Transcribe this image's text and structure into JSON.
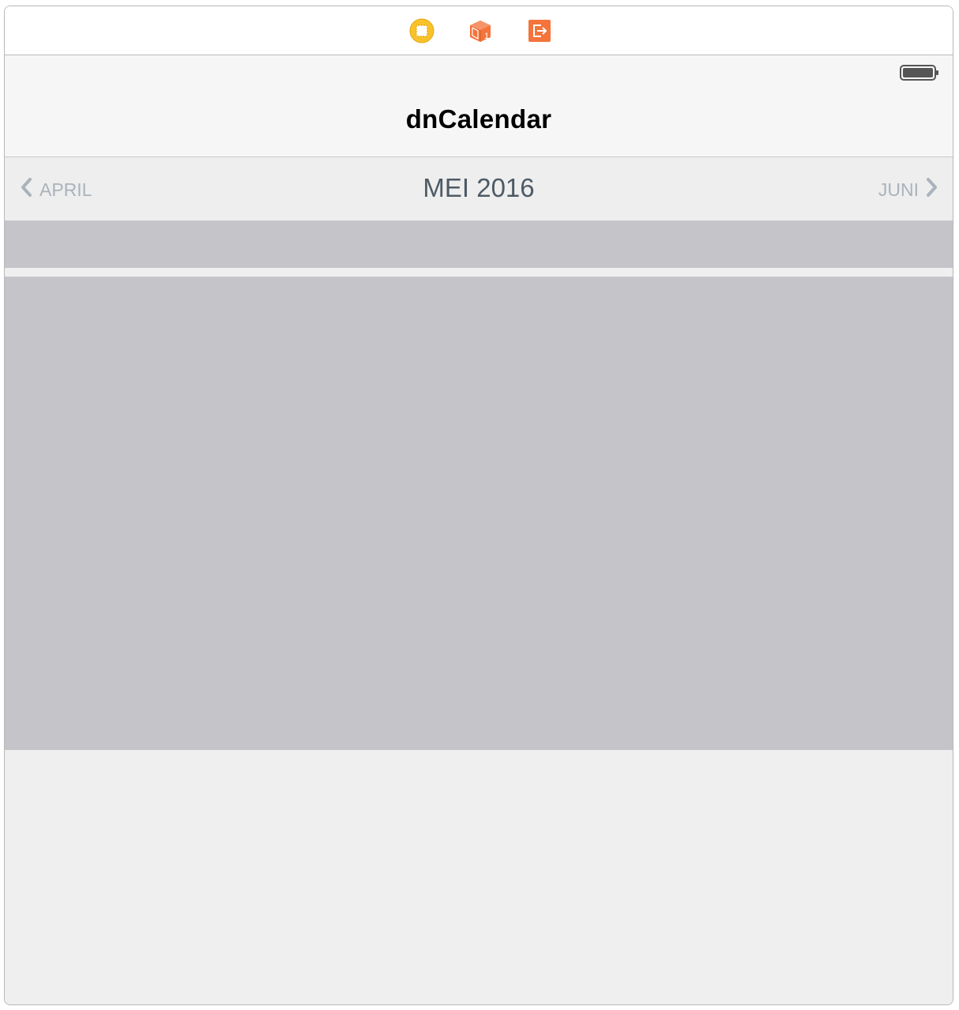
{
  "scene_dock": {
    "icons": [
      "view-controller-icon",
      "first-responder-icon",
      "exit-icon"
    ],
    "first_responder_badge": "1"
  },
  "navigation_bar": {
    "title": "dnCalendar"
  },
  "month_navigation": {
    "previous_label": "APRIL",
    "current_label": "MEI 2016",
    "next_label": "JUNI"
  },
  "colors": {
    "accent_orange": "#f4743b",
    "controller_yellow": "#f8c22a",
    "month_text": "#4d5a66",
    "month_side_text": "#aab3bb",
    "placeholder_gray": "#c5c4c9",
    "background": "#efefef"
  }
}
